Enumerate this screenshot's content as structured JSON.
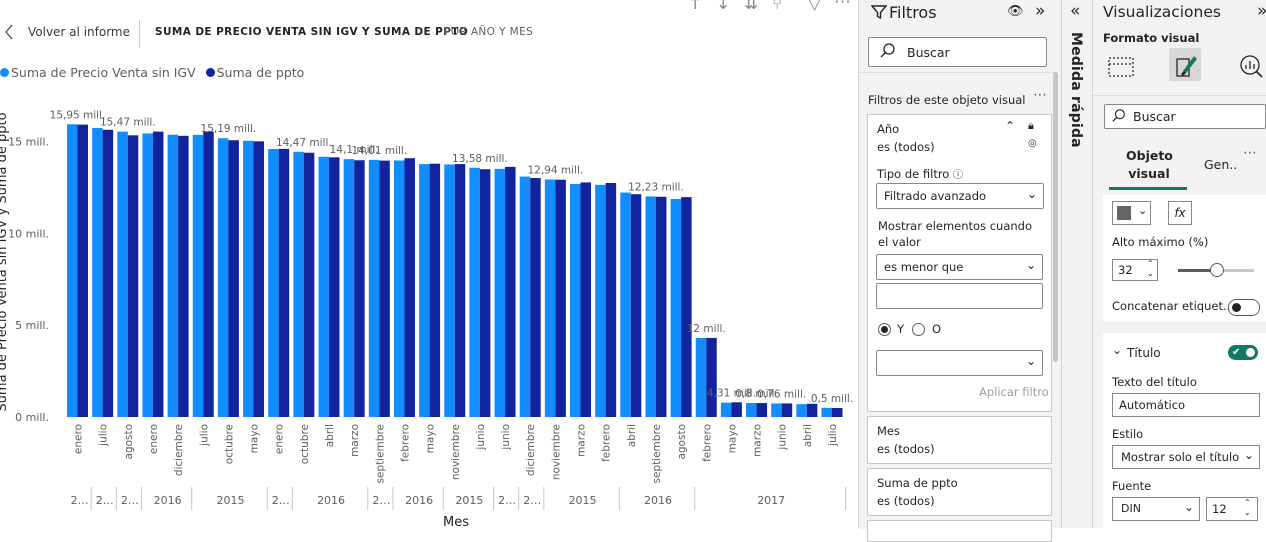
{
  "report": {
    "back_label": "Volver al informe",
    "breadcrumb_main": "SUMA DE PRECIO VENTA SIN IGV Y SUMA DE PPTO",
    "breadcrumb_sub": "POR AÑO Y MES",
    "legend": [
      {
        "name": "Suma de Precio Venta sin IGV",
        "color": "#118DFF"
      },
      {
        "name": "Suma de ppto",
        "color": "#12239E"
      }
    ]
  },
  "chart_data": {
    "type": "bar",
    "xlabel": "Mes",
    "ylabel": "Suma de Precio Venta sin IGV y Suma de ppto",
    "ylim": [
      0,
      17
    ],
    "yticks": [
      "0 mill.",
      "5 mill.",
      "10 mill.",
      "15 mill."
    ],
    "categories": [
      "enero",
      "julio",
      "agosto",
      "enero",
      "diciembre",
      "julio",
      "octubre",
      "mayo",
      "enero",
      "octubre",
      "abril",
      "marzo",
      "septiembre",
      "febrero",
      "mayo",
      "noviembre",
      "junio",
      "junio",
      "diciembre",
      "noviembre",
      "marzo",
      "febrero",
      "abril",
      "septiembre",
      "agosto",
      "febrero",
      "mayo",
      "marzo",
      "junio",
      "abril",
      "julio"
    ],
    "series": [
      {
        "name": "Suma de Precio Venta sin IGV",
        "values": [
          15.95,
          15.75,
          15.55,
          15.45,
          15.38,
          15.37,
          15.19,
          15.05,
          14.6,
          14.45,
          14.18,
          14.05,
          14.01,
          13.98,
          13.78,
          13.76,
          13.58,
          13.52,
          13.1,
          12.94,
          12.7,
          12.65,
          12.23,
          12.02,
          11.88,
          4.31,
          0.78,
          0.76,
          0.74,
          0.7,
          0.5
        ]
      },
      {
        "name": "Suma de ppto",
        "values": [
          15.93,
          15.65,
          15.35,
          15.55,
          15.32,
          15.55,
          15.08,
          15.02,
          14.61,
          14.4,
          14.15,
          13.99,
          13.97,
          14.1,
          13.8,
          13.78,
          13.5,
          13.63,
          13.02,
          12.93,
          12.78,
          12.75,
          12.14,
          12.0,
          11.98,
          4.31,
          0.8,
          0.76,
          0.74,
          0.72,
          0.49
        ]
      }
    ],
    "data_labels": [
      {
        "index": 0,
        "text": "15,95 mill."
      },
      {
        "index": 2,
        "text": "15,47 mill."
      },
      {
        "index": 6,
        "text": "15,19 mill."
      },
      {
        "index": 9,
        "text": "14,47 mill."
      },
      {
        "index": 11,
        "text": "14,1 mill."
      },
      {
        "index": 12,
        "text": "14,01 mill."
      },
      {
        "index": 16,
        "text": "13,58 mill."
      },
      {
        "index": 19,
        "text": "12,94 mill."
      },
      {
        "index": 23,
        "text": "12,23 mill."
      },
      {
        "index": 25,
        "text": "12 mill."
      },
      {
        "index": 26,
        "text": "4,31 mill."
      },
      {
        "index": 27,
        "text": "0,8 mill."
      },
      {
        "index": 28,
        "text": "0,76 mill."
      },
      {
        "index": 30,
        "text": "0,5 mill."
      }
    ],
    "year_groups": [
      {
        "label": "2…",
        "start": 0,
        "count": 1
      },
      {
        "label": "2…",
        "start": 1,
        "count": 1
      },
      {
        "label": "2…",
        "start": 2,
        "count": 1
      },
      {
        "label": "2016",
        "start": 3,
        "count": 2
      },
      {
        "label": "2015",
        "start": 5,
        "count": 3
      },
      {
        "label": "2…",
        "start": 8,
        "count": 1
      },
      {
        "label": "2016",
        "start": 9,
        "count": 3
      },
      {
        "label": "2…",
        "start": 12,
        "count": 1
      },
      {
        "label": "2016",
        "start": 13,
        "count": 2
      },
      {
        "label": "2015",
        "start": 15,
        "count": 2
      },
      {
        "label": "2…",
        "start": 17,
        "count": 1
      },
      {
        "label": "2…",
        "start": 18,
        "count": 1
      },
      {
        "label": "2015",
        "start": 19,
        "count": 3
      },
      {
        "label": "2016",
        "start": 22,
        "count": 3
      },
      {
        "label": "2017",
        "start": 25,
        "count": 6
      }
    ]
  },
  "filters": {
    "title": "Filtros",
    "search_placeholder": "Buscar",
    "section_label": "Filtros de este objeto visual",
    "year_card": {
      "field": "Año",
      "summary": "es (todos)",
      "filter_type_label": "Tipo de filtro",
      "filter_type_value": "Filtrado avanzado",
      "show_items_label": "Mostrar elementos cuando el valor",
      "condition_value": "es menor que",
      "and_label": "Y",
      "or_label": "O",
      "apply_label": "Aplicar filtro"
    },
    "cards": [
      {
        "field": "Mes",
        "summary": "es (todos)"
      },
      {
        "field": "Suma de ppto",
        "summary": "es (todos)"
      }
    ]
  },
  "quick_measure": {
    "label": "Medida rápida"
  },
  "visualizations": {
    "title": "Visualizaciones",
    "subtitle": "Formato visual",
    "search_placeholder": "Buscar",
    "tab_active": "Objeto visual",
    "tab_other": "Gen..",
    "max_height_label": "Alto máximo (%)",
    "max_height_value": "32",
    "max_height_fraction": 0.32,
    "concat_label": "Concatenar etiquet...",
    "title_section": "Título",
    "title_text_label": "Texto del título",
    "title_text_value": "Automático",
    "style_label": "Estilo",
    "style_value": "Mostrar solo el título",
    "font_label": "Fuente",
    "font_value": "DIN",
    "font_size": "12",
    "fx_label": "fx"
  }
}
